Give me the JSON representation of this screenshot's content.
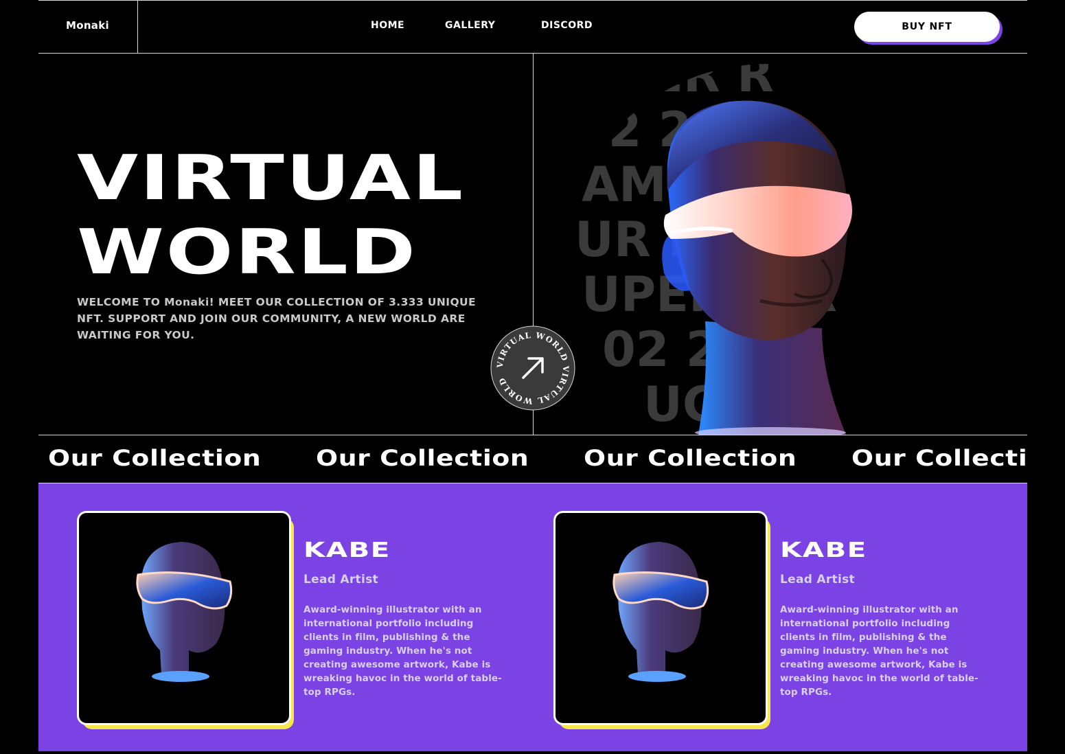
{
  "nav": {
    "logo": "Monaki",
    "links": [
      "HOME",
      "GALLERY",
      "DISCORD"
    ],
    "buy_label": "BUY NFT"
  },
  "hero": {
    "title_line1": "VIRTUAL",
    "title_line2": "WORLD",
    "description": "WELCOME TO Monaki! MEET OUR COLLECTION OF 3.333 UNIQUE NFT. SUPPORT AND JOIN OUR COMMUNITY, A NEW WORLD ARE WAITING FOR YOU.",
    "badge_text": "VIRTUAL WORLD VIRTUAL WORLD ",
    "badge_icon": "arrow-up-right-icon",
    "bg_lettering": [
      "ER R",
      "02 202",
      "AMEGO",
      "UR NFT",
      "UPERRAR",
      "02 202",
      "UGS"
    ]
  },
  "marquee": {
    "items": [
      "Our Collection",
      "Our Collection",
      "Our Collection",
      "Our Collection"
    ]
  },
  "team": {
    "members": [
      {
        "name": "KABE",
        "role": "Lead Artist",
        "bio": "Award-winning illustrator with an international portfolio including clients in film, publishing & the gaming industry. When he's not creating awesome artwork, Kabe is wreaking havoc in the world of table-top RPGs."
      },
      {
        "name": "KABE",
        "role": "Lead Artist",
        "bio": "Award-winning illustrator with an international portfolio including clients in film, publishing & the gaming industry. When he's not creating awesome artwork, Kabe is wreaking havoc in the world of table-top RPGs."
      }
    ]
  },
  "colors": {
    "accent_purple": "#7b43e4",
    "accent_yellow": "#f4e64b",
    "background": "#000000",
    "text": "#ffffff"
  }
}
